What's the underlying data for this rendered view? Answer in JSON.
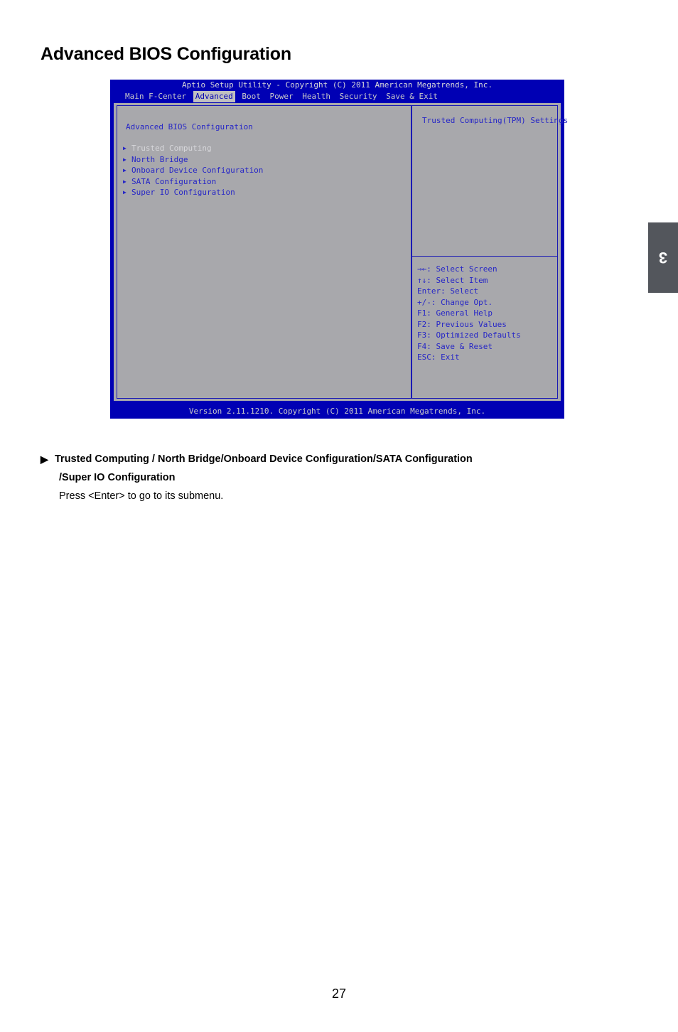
{
  "page": {
    "title": "Advanced BIOS Configuration",
    "number": "27",
    "chapter_tab": "3"
  },
  "bios": {
    "titlebar": "Aptio Setup Utility - Copyright (C) 2011 American Megatrends, Inc.",
    "menubar": [
      {
        "label": "Main F-Center",
        "active": false
      },
      {
        "label": "Advanced",
        "active": true
      },
      {
        "label": "Boot",
        "active": false
      },
      {
        "label": "Power",
        "active": false
      },
      {
        "label": "Health",
        "active": false
      },
      {
        "label": "Security",
        "active": false
      },
      {
        "label": "Save & Exit",
        "active": false
      }
    ],
    "section_heading": "Advanced BIOS Configuration",
    "menu_items": [
      {
        "marker": "▶",
        "label": "Trusted Computing",
        "selected": true
      },
      {
        "marker": "▶",
        "label": "North Bridge",
        "selected": false
      },
      {
        "marker": "▶",
        "label": "Onboard Device Configuration",
        "selected": false
      },
      {
        "marker": "▶",
        "label": "SATA Configuration",
        "selected": false
      },
      {
        "marker": "▶",
        "label": "Super IO Configuration",
        "selected": false
      }
    ],
    "help_text": "Trusted Computing(TPM) Settings",
    "key_legend": [
      "→←: Select Screen",
      "↑↓: Select Item",
      "Enter: Select",
      "+/-: Change Opt.",
      "F1: General Help",
      "F2: Previous Values",
      "F3: Optimized Defaults",
      "F4: Save & Reset",
      "ESC: Exit"
    ],
    "footer": "Version 2.11.1210. Copyright (C) 2011 American Megatrends, Inc.",
    "colors": {
      "background": "#0000b4",
      "panel": "#a8a8ac",
      "text": "#2626c6",
      "selected_text": "#d7d7db",
      "border": "#1a1ab4"
    }
  },
  "notes": {
    "bullet": "▶",
    "heading_line1": "Trusted Computing / North Bridge/Onboard Device Configuration/SATA Configuration",
    "heading_line2": "/Super IO Configuration",
    "body": "Press <Enter> to go to its submenu."
  }
}
